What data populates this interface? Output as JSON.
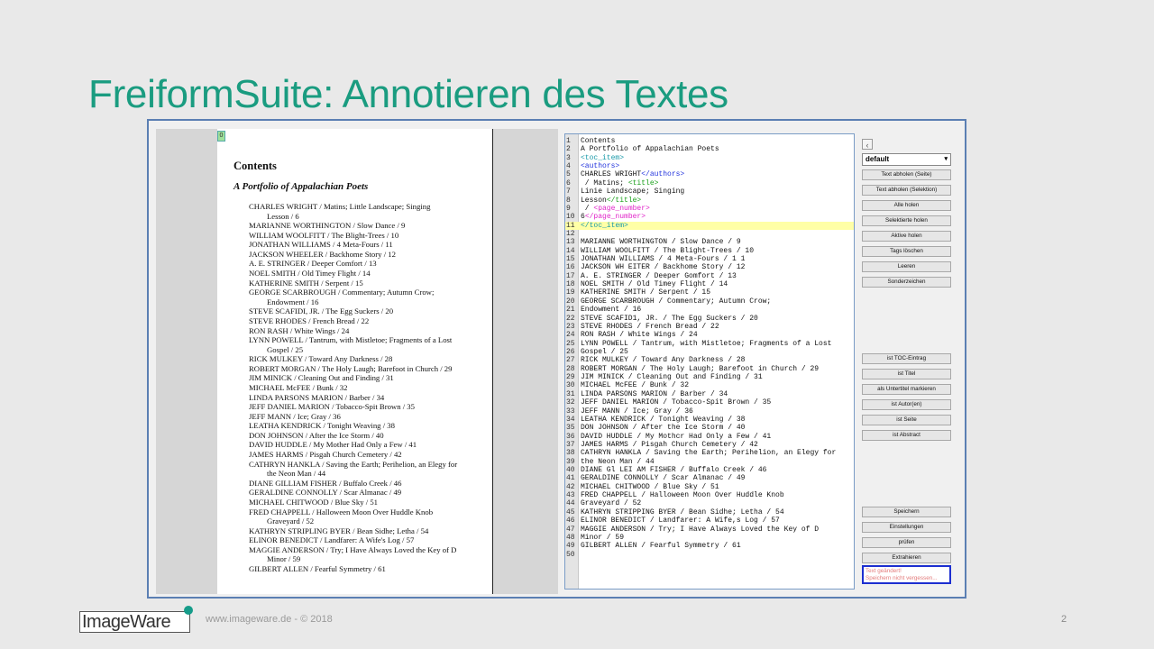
{
  "slide": {
    "title": "FreiformSuite: Annotieren des Textes",
    "footer": "www.imageware.de - © 2018",
    "page_number": "2",
    "logo_text": "ImageWare"
  },
  "document": {
    "marker": "0",
    "heading": "Contents",
    "subheading": "A Portfolio of Appalachian Poets",
    "entries": [
      {
        "text": "CHARLES WRIGHT / Matins; Little Landscape; Singing",
        "cont": false
      },
      {
        "text": "Lesson / 6",
        "cont": true
      },
      {
        "text": "MARIANNE WORTHINGTON / Slow Dance / 9",
        "cont": false
      },
      {
        "text": "WILLIAM WOOLFITT / The Blight-Trees / 10",
        "cont": false
      },
      {
        "text": "JONATHAN WILLIAMS / 4 Meta-Fours / 11",
        "cont": false
      },
      {
        "text": "JACKSON WHEELER / Backhome Story / 12",
        "cont": false
      },
      {
        "text": "A. E. STRINGER / Deeper Comfort / 13",
        "cont": false
      },
      {
        "text": "NOEL SMITH / Old Timey Flight / 14",
        "cont": false
      },
      {
        "text": "KATHERINE SMITH / Serpent / 15",
        "cont": false
      },
      {
        "text": "GEORGE SCARBROUGH / Commentary; Autumn Crow;",
        "cont": false
      },
      {
        "text": "Endowment / 16",
        "cont": true
      },
      {
        "text": "STEVE SCAFIDI, JR. / The Egg Suckers / 20",
        "cont": false
      },
      {
        "text": "STEVE RHODES / French Bread / 22",
        "cont": false
      },
      {
        "text": "RON RASH / White Wings / 24",
        "cont": false
      },
      {
        "text": "LYNN POWELL / Tantrum, with Mistletoe; Fragments of a Lost",
        "cont": false
      },
      {
        "text": "Gospel / 25",
        "cont": true
      },
      {
        "text": "RICK MULKEY / Toward Any Darkness / 28",
        "cont": false
      },
      {
        "text": "ROBERT MORGAN / The Holy Laugh; Barefoot in Church / 29",
        "cont": false
      },
      {
        "text": "JIM MINICK / Cleaning Out and Finding / 31",
        "cont": false
      },
      {
        "text": "MICHAEL McFEE / Bunk / 32",
        "cont": false
      },
      {
        "text": "LINDA PARSONS MARION / Barber / 34",
        "cont": false
      },
      {
        "text": "JEFF DANIEL MARION / Tobacco-Spit Brown / 35",
        "cont": false
      },
      {
        "text": "JEFF MANN / Ice; Gray / 36",
        "cont": false
      },
      {
        "text": "LEATHA KENDRICK / Tonight Weaving / 38",
        "cont": false
      },
      {
        "text": "DON JOHNSON / After the Ice Storm / 40",
        "cont": false
      },
      {
        "text": "DAVID HUDDLE / My Mother Had Only a Few / 41",
        "cont": false
      },
      {
        "text": "JAMES HARMS / Pisgah Church Cemetery / 42",
        "cont": false
      },
      {
        "text": "CATHRYN HANKLA / Saving the Earth; Perihelion, an Elegy for",
        "cont": false
      },
      {
        "text": "the Neon Man / 44",
        "cont": true
      },
      {
        "text": "DIANE GILLIAM FISHER / Buffalo Creek / 46",
        "cont": false
      },
      {
        "text": "GERALDINE CONNOLLY / Scar Almanac / 49",
        "cont": false
      },
      {
        "text": "MICHAEL CHITWOOD / Blue Sky / 51",
        "cont": false
      },
      {
        "text": "FRED CHAPPELL / Halloween Moon Over Huddle Knob",
        "cont": false
      },
      {
        "text": "Graveyard / 52",
        "cont": true
      },
      {
        "text": "KATHRYN STRIPLING BYER / Bean Sidhe; Letha / 54",
        "cont": false
      },
      {
        "text": "ELINOR BENEDICT / Landfarer: A Wife's Log / 57",
        "cont": false
      },
      {
        "text": "MAGGIE ANDERSON / Try; I Have Always Loved the Key of D",
        "cont": false
      },
      {
        "text": "Minor / 59",
        "cont": true
      },
      {
        "text": "GILBERT ALLEN / Fearful Symmetry / 61",
        "cont": false
      }
    ]
  },
  "editor": {
    "highlight_line": 11,
    "lines": [
      {
        "n": "1",
        "parts": [
          {
            "t": "Contents",
            "c": ""
          }
        ]
      },
      {
        "n": "2",
        "parts": [
          {
            "t": "A Portfolio of Appalachian Poets",
            "c": ""
          }
        ]
      },
      {
        "n": "3",
        "parts": [
          {
            "t": "<toc_item>",
            "c": "t-toc"
          }
        ]
      },
      {
        "n": "4",
        "parts": [
          {
            "t": "<authors>",
            "c": "t-auth"
          }
        ]
      },
      {
        "n": "5",
        "parts": [
          {
            "t": "CHARLES WRIGHT",
            "c": ""
          },
          {
            "t": "</authors>",
            "c": "t-auth"
          }
        ]
      },
      {
        "n": "6",
        "parts": [
          {
            "t": " / Matins; ",
            "c": ""
          },
          {
            "t": "<title>",
            "c": "t-title"
          }
        ]
      },
      {
        "n": "7",
        "parts": [
          {
            "t": "Linie Landscape; Singing",
            "c": ""
          }
        ]
      },
      {
        "n": "8",
        "parts": [
          {
            "t": "Lesson",
            "c": ""
          },
          {
            "t": "</title>",
            "c": "t-title"
          }
        ]
      },
      {
        "n": "9",
        "parts": [
          {
            "t": " / ",
            "c": ""
          },
          {
            "t": "<page_number>",
            "c": "t-page"
          }
        ]
      },
      {
        "n": "10",
        "parts": [
          {
            "t": "6",
            "c": ""
          },
          {
            "t": "</page_number>",
            "c": "t-page"
          }
        ]
      },
      {
        "n": "11",
        "parts": [
          {
            "t": "</toc_item>",
            "c": "t-toc"
          }
        ]
      },
      {
        "n": "12",
        "parts": [
          {
            "t": "",
            "c": ""
          }
        ]
      },
      {
        "n": "13",
        "parts": [
          {
            "t": "MARIANNE WORTHINGTON / Slow Dance / 9",
            "c": ""
          }
        ]
      },
      {
        "n": "14",
        "parts": [
          {
            "t": "WILLIAM WOOLFITT / The Blight-Trees / 10",
            "c": ""
          }
        ]
      },
      {
        "n": "15",
        "parts": [
          {
            "t": "JONATHAN WILLIAMS / 4 Meta-Fours / 1 1",
            "c": ""
          }
        ]
      },
      {
        "n": "16",
        "parts": [
          {
            "t": "JACKSON WH EITER / Backhome Story / 12",
            "c": ""
          }
        ]
      },
      {
        "n": "17",
        "parts": [
          {
            "t": "A. E. STRINGER / Deeper Gomfort / 13",
            "c": ""
          }
        ]
      },
      {
        "n": "18",
        "parts": [
          {
            "t": "NOEL SMITH / Old Timey Flight / 14",
            "c": ""
          }
        ]
      },
      {
        "n": "19",
        "parts": [
          {
            "t": "KATHERINE SMITH / Serpent / 15",
            "c": ""
          }
        ]
      },
      {
        "n": "20",
        "parts": [
          {
            "t": "GEORGE SCARBROUGH / Commentary; Autumn Crow;",
            "c": ""
          }
        ]
      },
      {
        "n": "21",
        "parts": [
          {
            "t": "Endowment / 16",
            "c": ""
          }
        ]
      },
      {
        "n": "22",
        "parts": [
          {
            "t": "STEVE SCAFID1, JR. / The Egg Suckers / 20",
            "c": ""
          }
        ]
      },
      {
        "n": "23",
        "parts": [
          {
            "t": "STEVE RHODES / French Bread / 22",
            "c": ""
          }
        ]
      },
      {
        "n": "24",
        "parts": [
          {
            "t": "RON RASH / White Wings / 24",
            "c": ""
          }
        ]
      },
      {
        "n": "25",
        "parts": [
          {
            "t": "LYNN POWELL / Tantrum, with Mistletoe; Fragments of a Lost",
            "c": ""
          }
        ]
      },
      {
        "n": "26",
        "parts": [
          {
            "t": "Gospel / 25",
            "c": ""
          }
        ]
      },
      {
        "n": "27",
        "parts": [
          {
            "t": "RICK MULKEY / Toward Any Darkness / 28",
            "c": ""
          }
        ]
      },
      {
        "n": "28",
        "parts": [
          {
            "t": "ROBERT MORGAN / The Holy Laugh; Barefoot in Church / 29",
            "c": ""
          }
        ]
      },
      {
        "n": "29",
        "parts": [
          {
            "t": "JIM MINICK / Cleaning Out and Finding / 31",
            "c": ""
          }
        ]
      },
      {
        "n": "30",
        "parts": [
          {
            "t": "MICHAEL McFEE / Bunk / 32",
            "c": ""
          }
        ]
      },
      {
        "n": "31",
        "parts": [
          {
            "t": "LINDA PARSONS MARION / Barber / 34",
            "c": ""
          }
        ]
      },
      {
        "n": "32",
        "parts": [
          {
            "t": "JEFF DANIEL MARION / Tobacco-Spit Brown / 35",
            "c": ""
          }
        ]
      },
      {
        "n": "33",
        "parts": [
          {
            "t": "JEFF MANN / Ice; Gray / 36",
            "c": ""
          }
        ]
      },
      {
        "n": "34",
        "parts": [
          {
            "t": "LEATHA KENDRICK / Tonight Weaving / 38",
            "c": ""
          }
        ]
      },
      {
        "n": "35",
        "parts": [
          {
            "t": "DON JOHNSON / After the Ice Storm / 40",
            "c": ""
          }
        ]
      },
      {
        "n": "36",
        "parts": [
          {
            "t": "DAVID HUDDLE / My Mothcr Had Only a Few / 41",
            "c": ""
          }
        ]
      },
      {
        "n": "37",
        "parts": [
          {
            "t": "JAMES HARMS / Pisgah Church Cemetery / 42",
            "c": ""
          }
        ]
      },
      {
        "n": "38",
        "parts": [
          {
            "t": "CATHRYN HANKLA / Saving the Earth; Perihelion, an Elegy for",
            "c": ""
          }
        ]
      },
      {
        "n": "39",
        "parts": [
          {
            "t": "the Neon Man / 44",
            "c": ""
          }
        ]
      },
      {
        "n": "40",
        "parts": [
          {
            "t": "DIANE Gl LEI AM FISHER / Buffalo Creek / 46",
            "c": ""
          }
        ]
      },
      {
        "n": "41",
        "parts": [
          {
            "t": "GERALDINE CONNOLLY / Scar Almanac / 49",
            "c": ""
          }
        ]
      },
      {
        "n": "42",
        "parts": [
          {
            "t": "MICHAEL CHITWOOD / Blue Sky / 51",
            "c": ""
          }
        ]
      },
      {
        "n": "43",
        "parts": [
          {
            "t": "FRED CHAPPELL / Halloween Moon Over Huddle Knob",
            "c": ""
          }
        ]
      },
      {
        "n": "44",
        "parts": [
          {
            "t": "Graveyard / 52",
            "c": ""
          }
        ]
      },
      {
        "n": "45",
        "parts": [
          {
            "t": "KATHRYN STRIPPING BYER / Bean Sidhe; Letha / 54",
            "c": ""
          }
        ]
      },
      {
        "n": "46",
        "parts": [
          {
            "t": "ELINOR BENEDICT / Landfarer: A Wife,s Log / 57",
            "c": ""
          }
        ]
      },
      {
        "n": "47",
        "parts": [
          {
            "t": "MAGGIE ANDERSON / Try; I Have Always Loved the Key of D",
            "c": ""
          }
        ]
      },
      {
        "n": "48",
        "parts": [
          {
            "t": "Minor / 59",
            "c": ""
          }
        ]
      },
      {
        "n": "49",
        "parts": [
          {
            "t": "GILBERT ALLEN / Fearful Symmetry / 61",
            "c": ""
          }
        ]
      },
      {
        "n": "50",
        "parts": [
          {
            "t": "",
            "c": ""
          }
        ]
      }
    ]
  },
  "panel": {
    "back_icon": "chevron-left-icon",
    "profile_select": "default",
    "buttons_top": [
      "Text abholen (Seite)",
      "Text abholen (Selektion)",
      "Alle holen",
      "Selektierte holen",
      "Aktive holen",
      "Tags löschen",
      "Leeren",
      "Sonderzeichen"
    ],
    "buttons_tags": [
      "ist TOC-Eintrag",
      "ist Titel",
      "als Untertitel markieren",
      "ist Autor(en)",
      "ist Seite",
      "ist Abstract"
    ],
    "buttons_bottom": [
      "Speichern",
      "Einstellungen",
      "prüfen",
      "Extrahieren"
    ],
    "notice_line1": "Text geändert!",
    "notice_line2": "Speichern nicht vergessen..."
  },
  "colors": {
    "title": "#1a9c80",
    "frame_border": "#5b7fb3",
    "highlight": "#ffffa6",
    "tag_toc": "#1a9aa9",
    "tag_authors": "#2233dd",
    "tag_title": "#1aa01a",
    "tag_page": "#e020c8",
    "notice_text": "#e37b7b",
    "notice_border": "#1d2fd0"
  }
}
